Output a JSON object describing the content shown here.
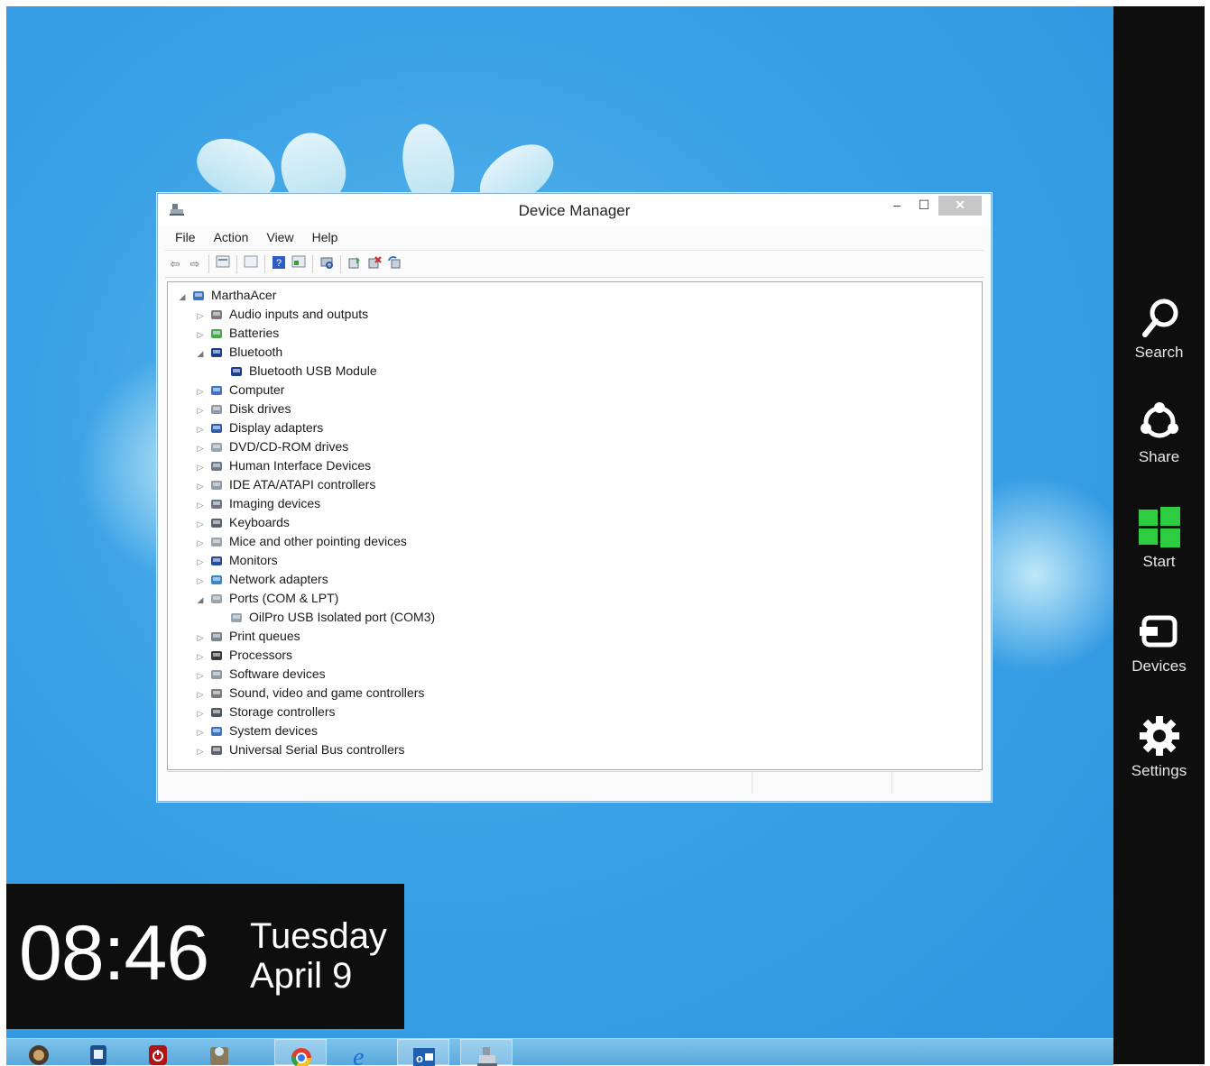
{
  "window": {
    "title": "Device Manager",
    "controls": {
      "minimize": "–",
      "maximize": "☐",
      "close": "✕"
    }
  },
  "menu": [
    "File",
    "Action",
    "View",
    "Help"
  ],
  "toolbar_icons": [
    "back-icon",
    "forward-icon",
    "properties-icon",
    "show-hidden-icon",
    "help-icon",
    "console-icon",
    "scan-hardware-icon",
    "update-driver-icon",
    "uninstall-icon",
    "rollback-icon"
  ],
  "tree": [
    {
      "label": "MarthaAcer",
      "level": 0,
      "expander": "expanded",
      "icon": "computer-icon"
    },
    {
      "label": "Audio inputs and outputs",
      "level": 1,
      "expander": "collapsed",
      "icon": "speaker-icon"
    },
    {
      "label": "Batteries",
      "level": 1,
      "expander": "collapsed",
      "icon": "battery-icon"
    },
    {
      "label": "Bluetooth",
      "level": 1,
      "expander": "expanded",
      "icon": "bluetooth-icon"
    },
    {
      "label": "Bluetooth USB Module",
      "level": 2,
      "expander": "none",
      "icon": "bluetooth-device-icon"
    },
    {
      "label": "Computer",
      "level": 1,
      "expander": "collapsed",
      "icon": "computer-icon"
    },
    {
      "label": "Disk drives",
      "level": 1,
      "expander": "collapsed",
      "icon": "disk-icon"
    },
    {
      "label": "Display adapters",
      "level": 1,
      "expander": "collapsed",
      "icon": "display-icon"
    },
    {
      "label": "DVD/CD-ROM drives",
      "level": 1,
      "expander": "collapsed",
      "icon": "dvd-icon"
    },
    {
      "label": "Human Interface Devices",
      "level": 1,
      "expander": "collapsed",
      "icon": "hid-icon"
    },
    {
      "label": "IDE ATA/ATAPI controllers",
      "level": 1,
      "expander": "collapsed",
      "icon": "ide-icon"
    },
    {
      "label": "Imaging devices",
      "level": 1,
      "expander": "collapsed",
      "icon": "camera-icon"
    },
    {
      "label": "Keyboards",
      "level": 1,
      "expander": "collapsed",
      "icon": "keyboard-icon"
    },
    {
      "label": "Mice and other pointing devices",
      "level": 1,
      "expander": "collapsed",
      "icon": "mouse-icon"
    },
    {
      "label": "Monitors",
      "level": 1,
      "expander": "collapsed",
      "icon": "monitor-icon"
    },
    {
      "label": "Network adapters",
      "level": 1,
      "expander": "collapsed",
      "icon": "network-icon"
    },
    {
      "label": "Ports (COM & LPT)",
      "level": 1,
      "expander": "expanded",
      "icon": "port-icon"
    },
    {
      "label": "OilPro USB Isolated port (COM3)",
      "level": 2,
      "expander": "none",
      "icon": "port-icon"
    },
    {
      "label": "Print queues",
      "level": 1,
      "expander": "collapsed",
      "icon": "printer-icon"
    },
    {
      "label": "Processors",
      "level": 1,
      "expander": "collapsed",
      "icon": "processor-icon"
    },
    {
      "label": "Software devices",
      "level": 1,
      "expander": "collapsed",
      "icon": "software-device-icon"
    },
    {
      "label": "Sound, video and game controllers",
      "level": 1,
      "expander": "collapsed",
      "icon": "speaker-icon"
    },
    {
      "label": "Storage controllers",
      "level": 1,
      "expander": "collapsed",
      "icon": "storage-icon"
    },
    {
      "label": "System devices",
      "level": 1,
      "expander": "collapsed",
      "icon": "computer-icon"
    },
    {
      "label": "Universal Serial Bus controllers",
      "level": 1,
      "expander": "collapsed",
      "icon": "usb-icon"
    }
  ],
  "charms": [
    {
      "label": "Search",
      "icon": "search-icon"
    },
    {
      "label": "Share",
      "icon": "share-icon"
    },
    {
      "label": "Start",
      "icon": "windows-start-icon"
    },
    {
      "label": "Devices",
      "icon": "devices-icon"
    },
    {
      "label": "Settings",
      "icon": "gear-icon"
    }
  ],
  "clock": {
    "time": "08:46",
    "day": "Tuesday",
    "date": "April 9"
  },
  "taskbar": [
    {
      "icon": "speaker-app-icon"
    },
    {
      "icon": "notes-app-icon"
    },
    {
      "icon": "power-app-icon"
    },
    {
      "icon": "photos-app-icon"
    },
    {
      "icon": "chrome-icon",
      "active": true
    },
    {
      "icon": "internet-explorer-icon"
    },
    {
      "icon": "outlook-icon",
      "active": true
    },
    {
      "icon": "device-manager-icon",
      "active": true
    }
  ],
  "colors": {
    "desktop": "#3aa1e6",
    "charms_bg": "#0e0e0e",
    "start_tile": "#2ecc40",
    "window_border": "#8bb2d4",
    "close_button": "#c7c7c7"
  }
}
